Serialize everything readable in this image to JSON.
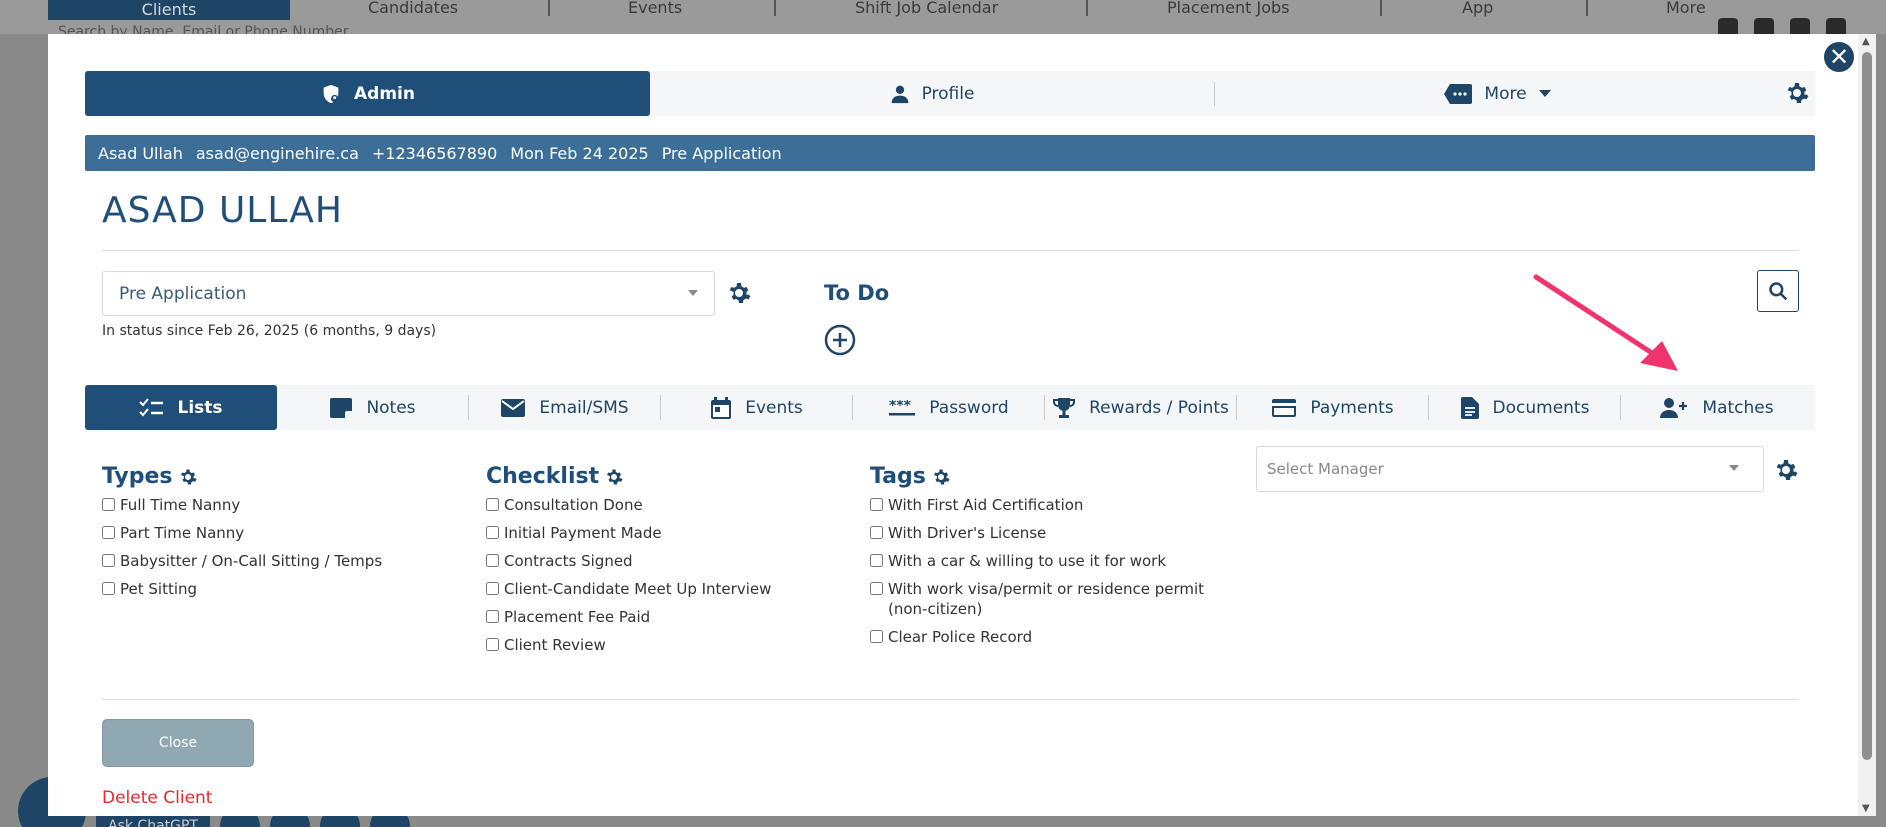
{
  "background": {
    "nav": [
      {
        "label": "Clients",
        "icon": "clients-icon",
        "active": true
      },
      {
        "label": "Candidates",
        "icon": "id-card-icon"
      },
      {
        "label": "Events",
        "icon": "trophy-icon"
      },
      {
        "label": "Shift Job Calendar",
        "icon": "calendar-icon"
      },
      {
        "label": "Placement Jobs",
        "icon": "folder-icon"
      },
      {
        "label": "App",
        "icon": "phone-icon"
      },
      {
        "label": "More",
        "icon": "tag-icon"
      }
    ],
    "search_placeholder": "Search by Name, Email or Phone Number",
    "ask_label": "Ask ChatGPT"
  },
  "modal": {
    "close_icon": "close-icon",
    "topnav": {
      "admin_label": "Admin",
      "profile_label": "Profile",
      "more_label": "More"
    },
    "info": {
      "name": "Asad Ullah",
      "email": "asad@enginehire.ca",
      "phone": "+12346567890",
      "date": "Mon Feb 24 2025",
      "status": "Pre Application"
    },
    "title": "ASAD ULLAH",
    "status": {
      "selected": "Pre Application",
      "since": "In status since Feb 26, 2025 (6 months, 9 days)"
    },
    "todo": {
      "title": "To Do"
    },
    "tabs": [
      {
        "label": "Lists",
        "icon": "checklist-icon",
        "active": true
      },
      {
        "label": "Notes",
        "icon": "note-icon"
      },
      {
        "label": "Email/SMS",
        "icon": "envelope-icon"
      },
      {
        "label": "Events",
        "icon": "calendar-icon"
      },
      {
        "label": "Password",
        "icon": "password-icon"
      },
      {
        "label": "Rewards / Points",
        "icon": "trophy-icon"
      },
      {
        "label": "Payments",
        "icon": "credit-card-icon"
      },
      {
        "label": "Documents",
        "icon": "document-icon"
      },
      {
        "label": "Matches",
        "icon": "user-plus-icon"
      }
    ],
    "types": {
      "title": "Types",
      "items": [
        "Full Time Nanny",
        "Part Time Nanny",
        "Babysitter / On-Call Sitting / Temps",
        "Pet Sitting"
      ]
    },
    "checklist": {
      "title": "Checklist",
      "items": [
        "Consultation Done",
        "Initial Payment Made",
        "Contracts Signed",
        "Client-Candidate Meet Up Interview",
        "Placement Fee Paid",
        "Client Review"
      ]
    },
    "tags": {
      "title": "Tags",
      "items": [
        "With First Aid Certification",
        "With Driver's License",
        "With a car & willing to use it for work",
        "With work visa/permit or residence permit (non-citizen)",
        "Clear Police Record"
      ]
    },
    "manager": {
      "placeholder": "Select Manager"
    },
    "close_label": "Close",
    "delete_label": "Delete Client"
  },
  "colors": {
    "primary": "#1f4e79",
    "info_bar": "#3c6e98",
    "danger": "#e8262b",
    "arrow": "#f0336c",
    "close_button": "#8fa8b1"
  }
}
